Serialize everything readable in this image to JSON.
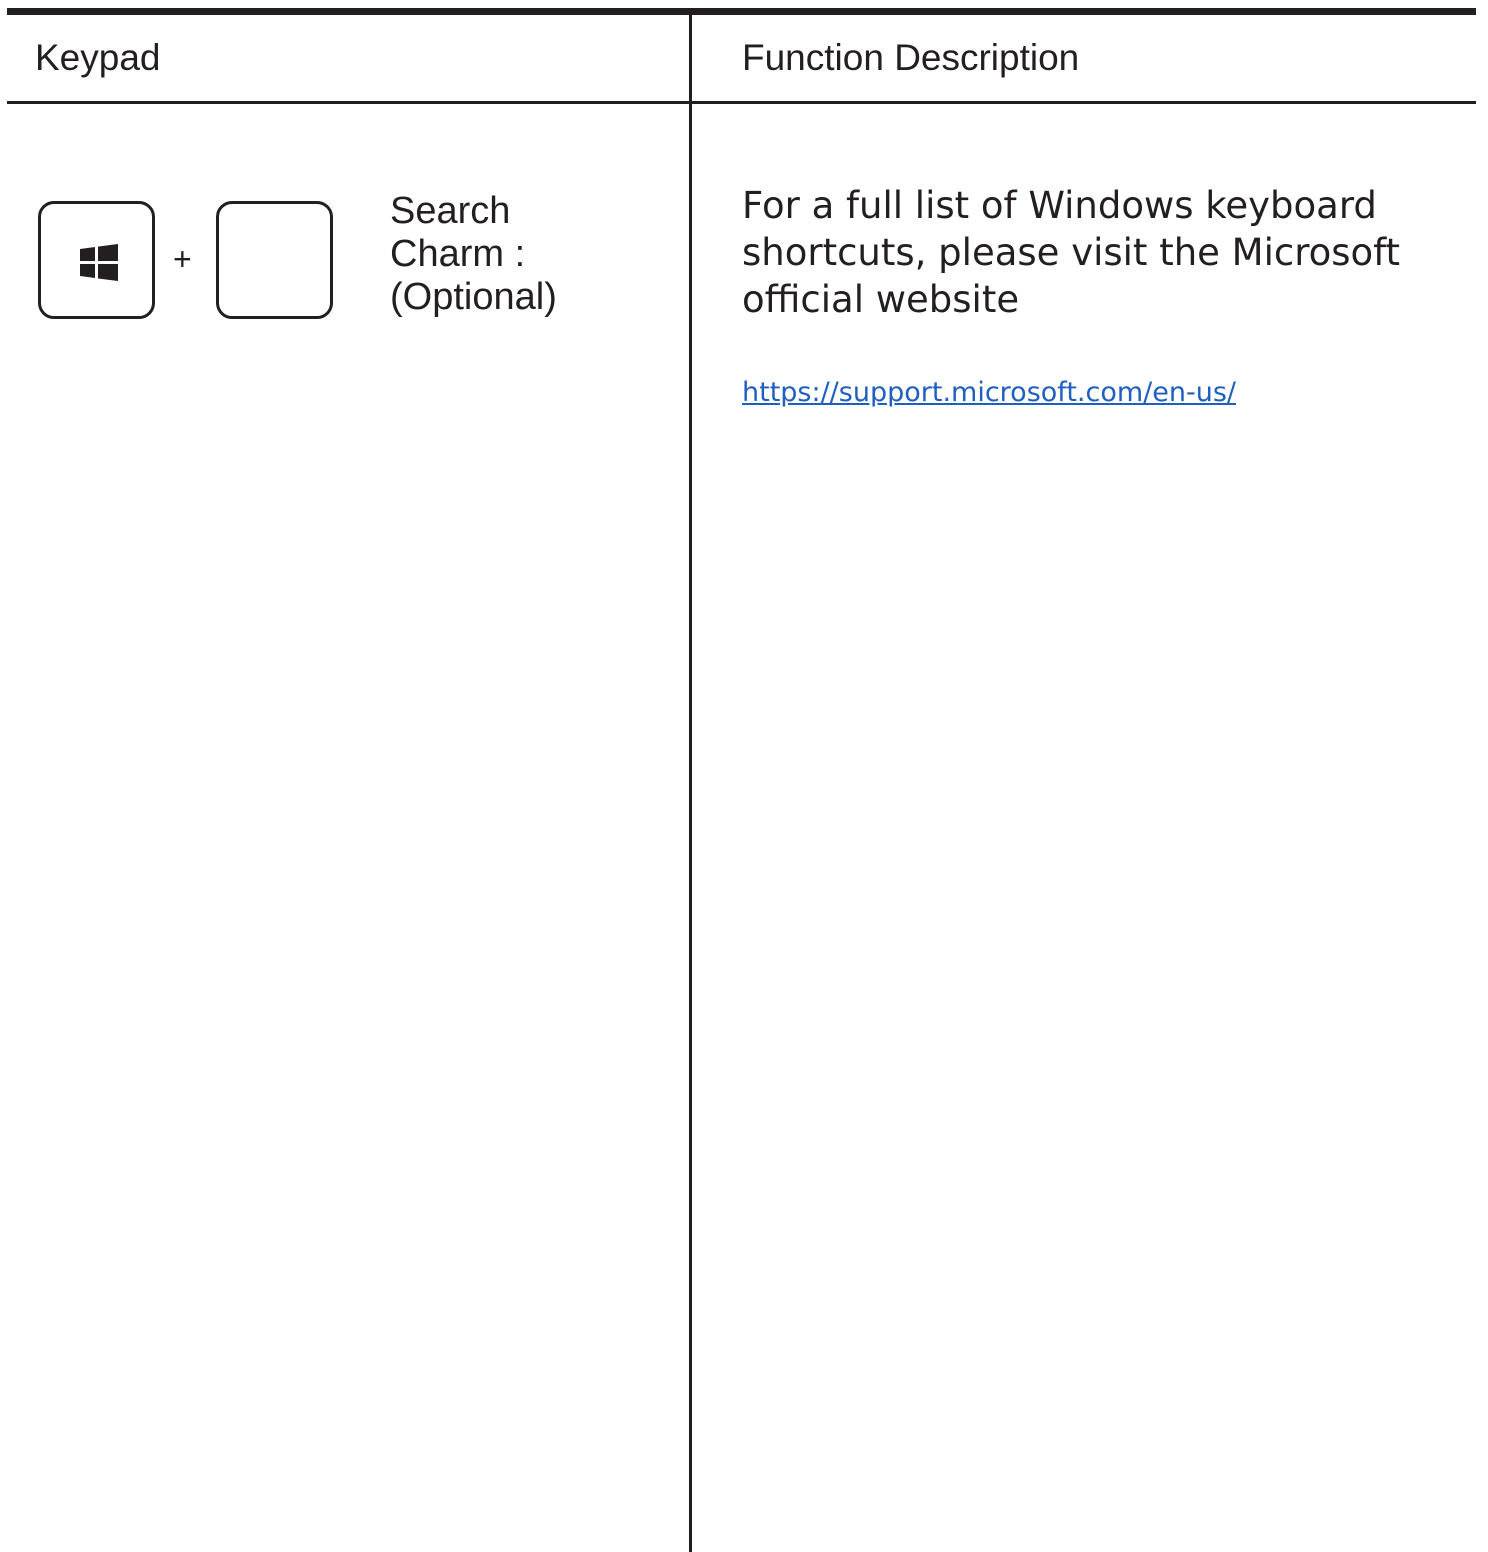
{
  "table": {
    "headers": {
      "keypad": "Keypad",
      "function": "Function Description"
    },
    "row": {
      "keys": [
        "windows-icon",
        "blank-key"
      ],
      "plus": "+",
      "label_lines": [
        "Search",
        "Charm :",
        "(Optional)"
      ],
      "description_lines": [
        "For a full list of Windows keyboard",
        "shortcuts, please visit the Microsoft",
        "official website"
      ],
      "link_text": "https://support.microsoft.com/en-us/"
    }
  },
  "colors": {
    "ink": "#231f20",
    "link": "#1f5fbf"
  }
}
